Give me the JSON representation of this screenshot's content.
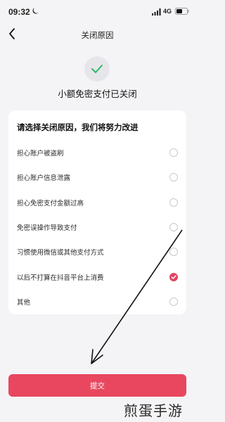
{
  "status_bar": {
    "time": "09:32",
    "network": "4G",
    "icons": [
      "moon-icon",
      "signal-icon",
      "battery-icon"
    ]
  },
  "nav": {
    "title": "关闭原因",
    "back_icon": "back-chevron-icon"
  },
  "result": {
    "icon": "check-icon",
    "text": "小额免密支付已关闭"
  },
  "reasons": {
    "title": "请选择关闭原因，我们将努力改进",
    "options": [
      {
        "label": "担心账户被盗刷",
        "selected": false
      },
      {
        "label": "担心账户信息泄露",
        "selected": false
      },
      {
        "label": "担心免密支付金额过高",
        "selected": false
      },
      {
        "label": "免密误操作导致支付",
        "selected": false
      },
      {
        "label": "习惯使用微信或其他支付方式",
        "selected": false
      },
      {
        "label": "以后不打算在抖音平台上消费",
        "selected": true
      },
      {
        "label": "其他",
        "selected": false
      }
    ]
  },
  "submit": {
    "label": "提交"
  },
  "watermark": "煎蛋手游",
  "colors": {
    "background": "#f4f4f6",
    "accent": "#e8475f",
    "check_green": "#2fb866"
  }
}
